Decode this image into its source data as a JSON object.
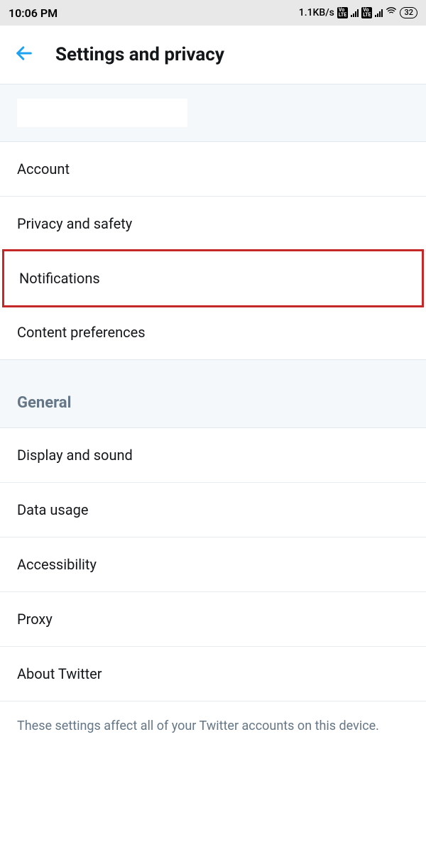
{
  "status": {
    "time": "10:06 PM",
    "speed": "1.1KB/s",
    "lte1": "Vo LTE",
    "lte2": "Vo LTE",
    "battery": "32"
  },
  "header": {
    "title": "Settings and privacy"
  },
  "section1": {
    "items": [
      {
        "label": "Account"
      },
      {
        "label": "Privacy and safety"
      },
      {
        "label": "Notifications",
        "highlighted": true
      },
      {
        "label": "Content preferences"
      }
    ]
  },
  "section2": {
    "title": "General",
    "items": [
      {
        "label": "Display and sound"
      },
      {
        "label": "Data usage"
      },
      {
        "label": "Accessibility"
      },
      {
        "label": "Proxy"
      },
      {
        "label": "About Twitter"
      }
    ]
  },
  "footer": {
    "note": "These settings affect all of your Twitter accounts on this device."
  }
}
